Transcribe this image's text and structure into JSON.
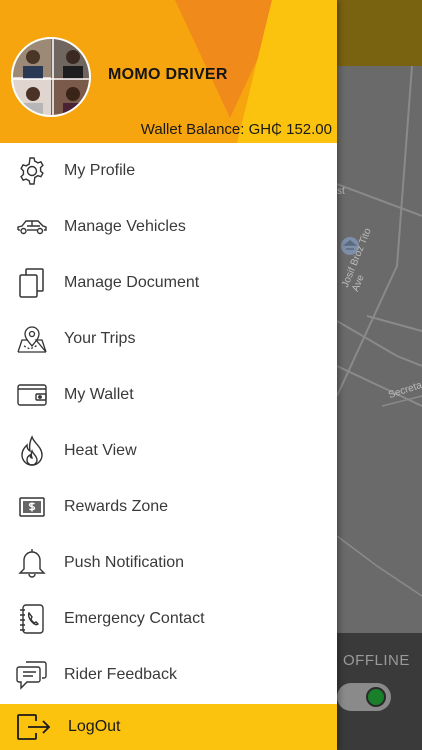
{
  "header": {
    "driver_name": "MOMO DRIVER",
    "wallet_balance": "Wallet Balance: GH₵ 152.00"
  },
  "menu": {
    "items": [
      {
        "label": "My Profile",
        "icon": "gear-icon"
      },
      {
        "label": "Manage Vehicles",
        "icon": "car-icon"
      },
      {
        "label": "Manage Document",
        "icon": "documents-icon"
      },
      {
        "label": "Your Trips",
        "icon": "map-pin-icon"
      },
      {
        "label": "My Wallet",
        "icon": "wallet-icon"
      },
      {
        "label": "Heat View",
        "icon": "flame-icon"
      },
      {
        "label": "Rewards Zone",
        "icon": "dollar-card-icon"
      },
      {
        "label": "Push Notification",
        "icon": "bell-icon"
      },
      {
        "label": "Emergency Contact",
        "icon": "phone-book-icon"
      },
      {
        "label": "Rider Feedback",
        "icon": "chat-icon"
      }
    ],
    "logout_label": "LogOut"
  },
  "map": {
    "street_labels": [
      "st",
      "Josif Broz Tito Ave",
      "Secreta"
    ],
    "status_label": "OFFLINE"
  },
  "colors": {
    "header_orange": "#f6a50e",
    "accent_yellow": "#fbc20e",
    "online_green": "#1a7f2a"
  }
}
